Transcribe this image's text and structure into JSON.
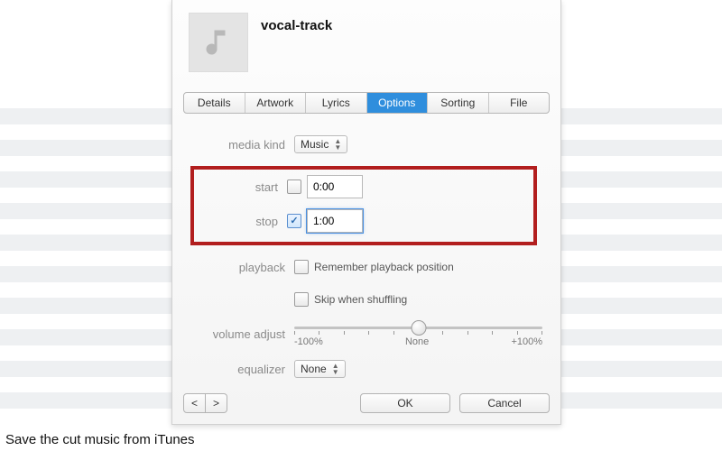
{
  "track": {
    "title": "vocal-track"
  },
  "tabs": [
    {
      "label": "Details"
    },
    {
      "label": "Artwork"
    },
    {
      "label": "Lyrics"
    },
    {
      "label": "Options"
    },
    {
      "label": "Sorting"
    },
    {
      "label": "File"
    }
  ],
  "form": {
    "media_kind_label": "media kind",
    "media_kind_value": "Music",
    "start_label": "start",
    "start_value": "0:00",
    "start_checked": false,
    "stop_label": "stop",
    "stop_value": "1:00",
    "stop_checked": true,
    "playback_label": "playback",
    "remember_position": "Remember playback position",
    "skip_shuffling": "Skip when shuffling",
    "volume_label": "volume adjust",
    "volume_min": "-100%",
    "volume_mid": "None",
    "volume_max": "+100%",
    "equalizer_label": "equalizer",
    "equalizer_value": "None"
  },
  "buttons": {
    "ok": "OK",
    "cancel": "Cancel",
    "prev": "<",
    "next": ">"
  },
  "caption": "Save the cut music from iTunes"
}
